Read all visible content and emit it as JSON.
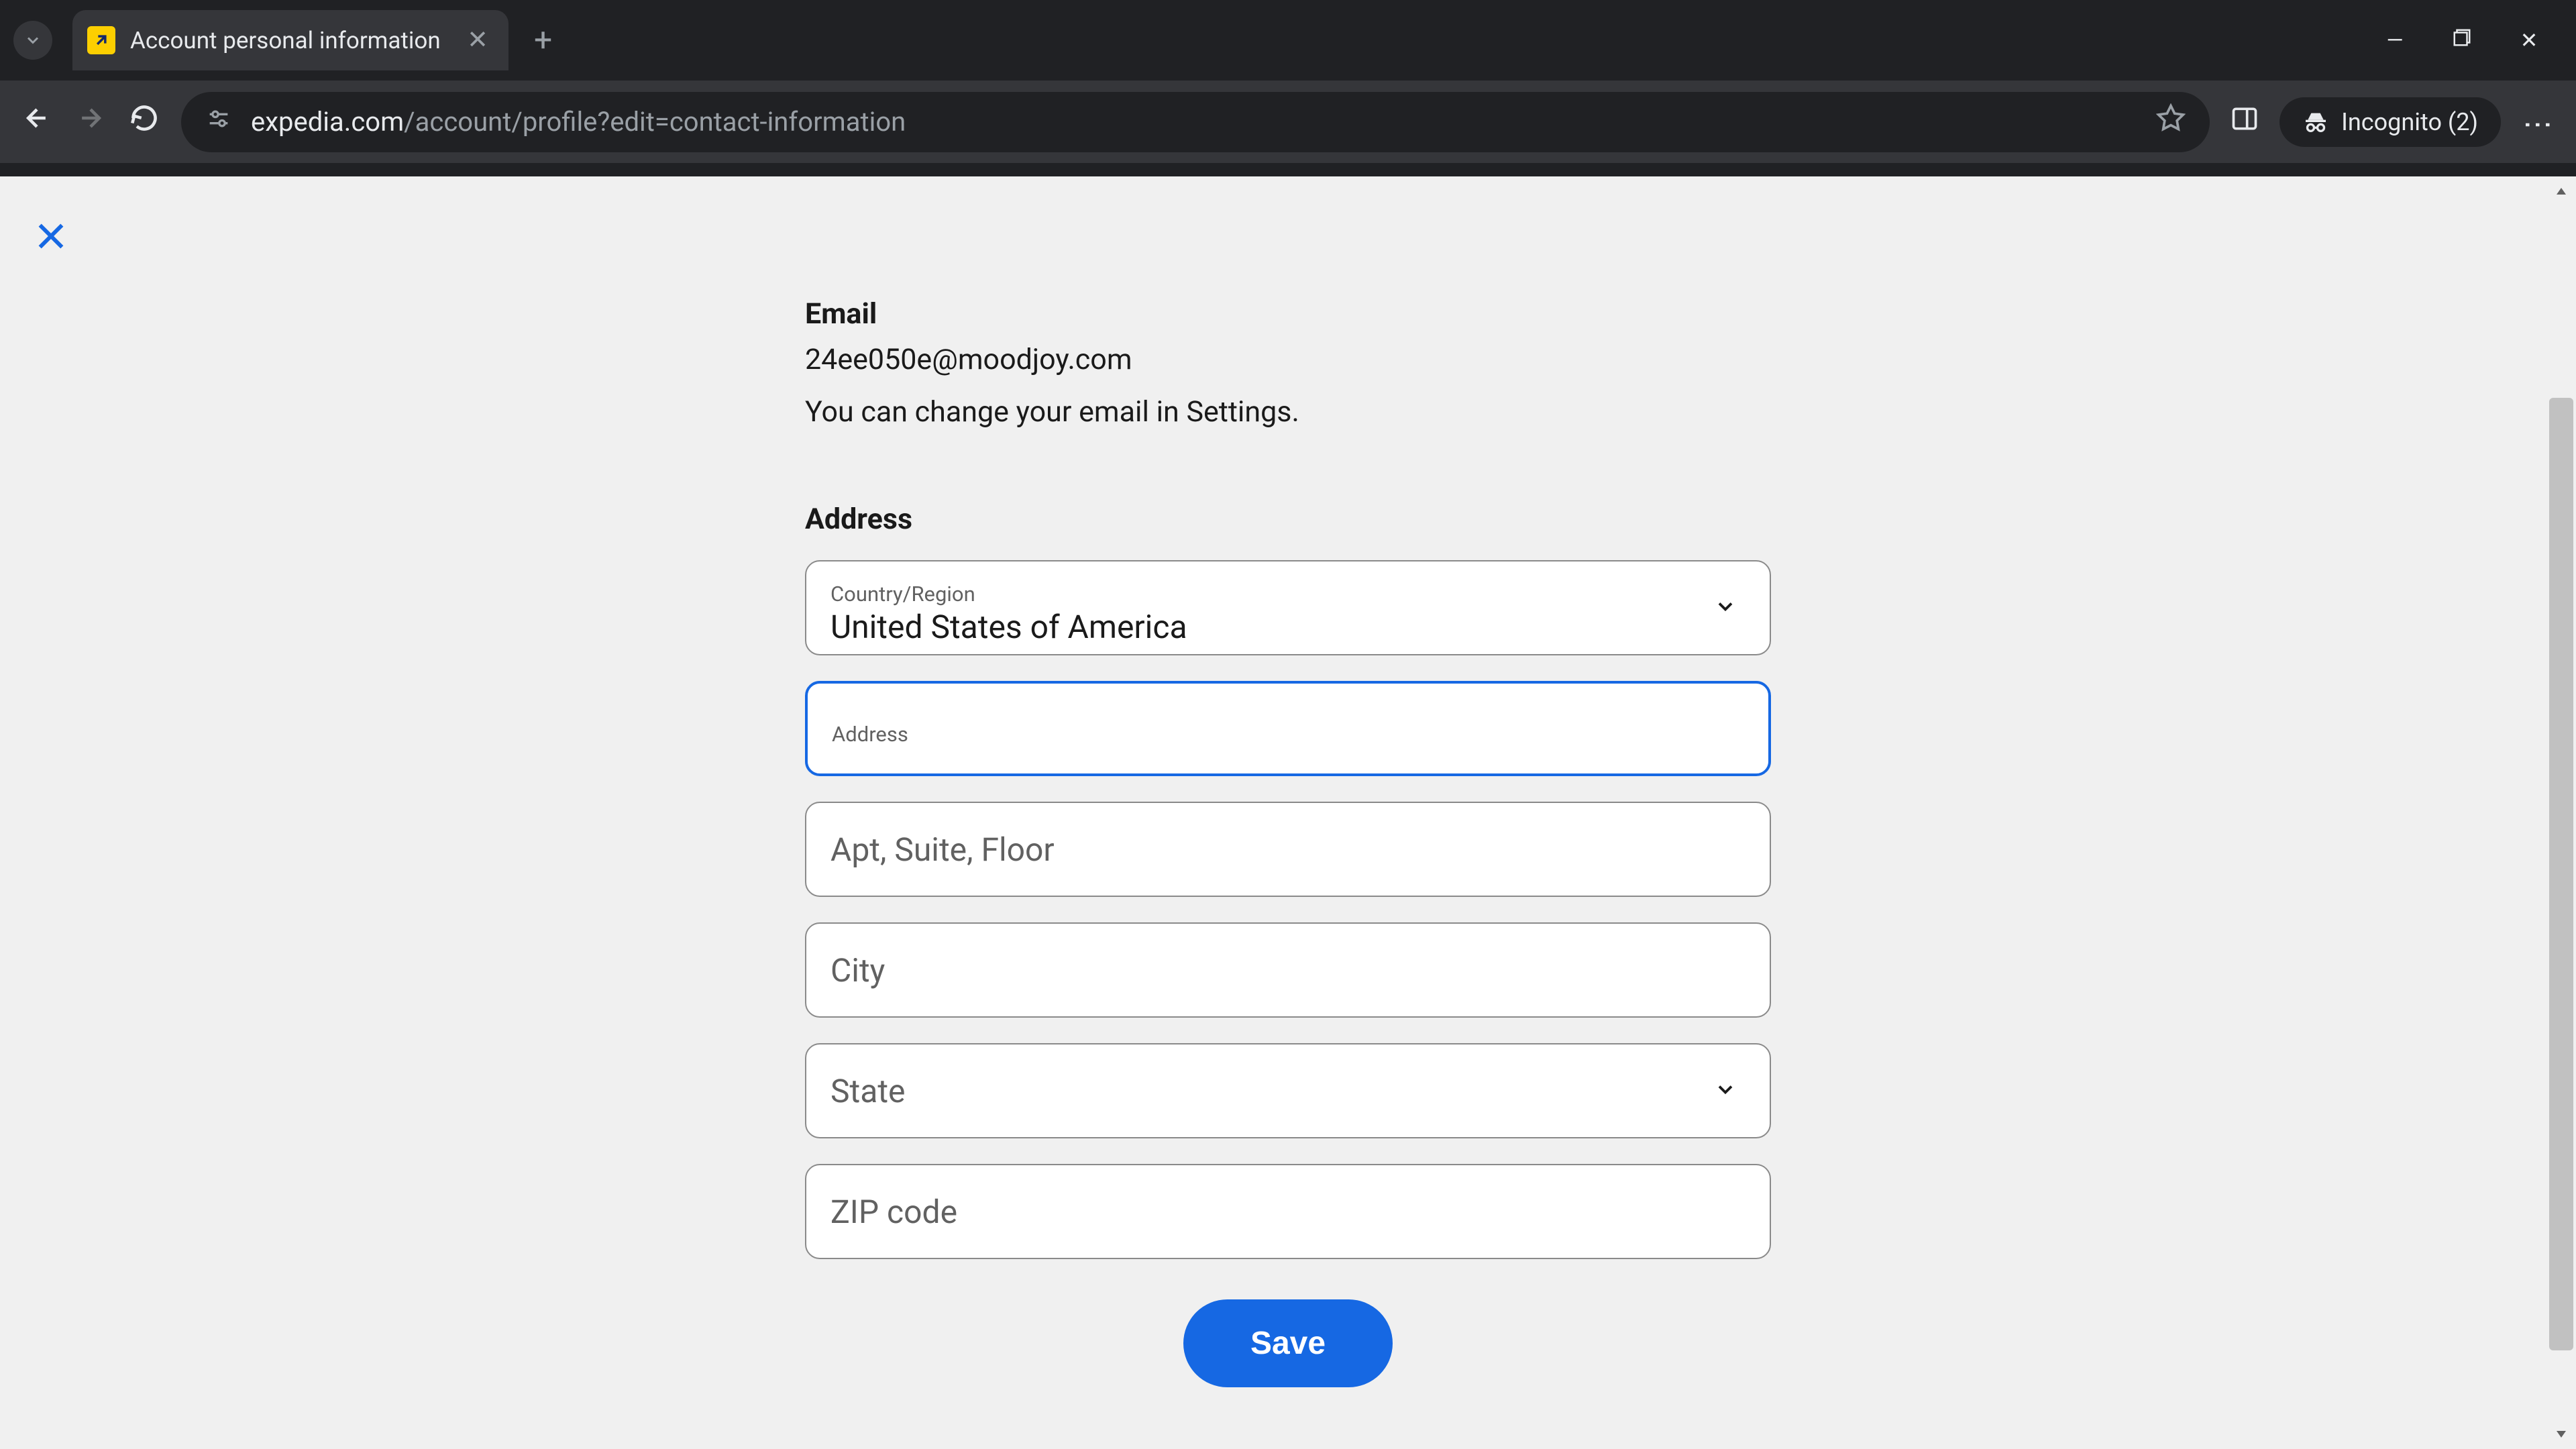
{
  "browser": {
    "tab_title": "Account personal information",
    "url_domain": "expedia.com",
    "url_path": "/account/profile?edit=contact-information",
    "incognito_label": "Incognito (2)"
  },
  "page": {
    "email_label": "Email",
    "email_value": "24ee050e@moodjoy.com",
    "email_note": "You can change your email in Settings.",
    "address_heading": "Address",
    "country_label": "Country/Region",
    "country_value": "United States of America",
    "address_label": "Address",
    "apt_placeholder": "Apt, Suite, Floor",
    "city_placeholder": "City",
    "state_placeholder": "State",
    "zip_placeholder": "ZIP code",
    "save_label": "Save"
  }
}
